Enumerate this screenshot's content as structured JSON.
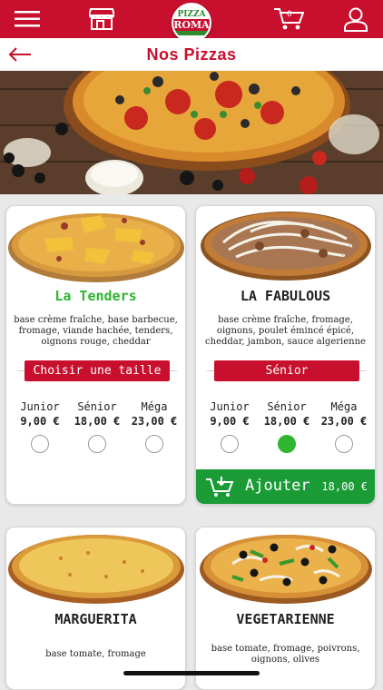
{
  "header": {
    "logo_line1": "PIZZA",
    "logo_line2": "ROMA",
    "cart_count": "0",
    "icons": [
      "menu-icon",
      "store-icon",
      "cart-icon",
      "user-icon"
    ],
    "accent_color": "#c8102e"
  },
  "titlebar": {
    "title": "Nos Pizzas",
    "back_icon": "arrow-left-icon"
  },
  "pizzas": [
    {
      "name": "La Tenders",
      "description": "base crème fraîche, base barbecue, fromage, viande hachée, tenders, oignons rouge, cheddar",
      "select_label": "Choisir une taille",
      "sizes": [
        {
          "label": "Junior",
          "price": "9,00 €",
          "selected": false
        },
        {
          "label": "Sénior",
          "price": "18,00 €",
          "selected": false
        },
        {
          "label": "Méga",
          "price": "23,00 €",
          "selected": false
        }
      ]
    },
    {
      "name": "LA FABULOUS",
      "description": "base crème fraîche, fromage, oignons, poulet émincé épicé, cheddar, jambon, sauce algerienne",
      "select_label": "Sénior",
      "sizes": [
        {
          "label": "Junior",
          "price": "9,00 €",
          "selected": false
        },
        {
          "label": "Sénior",
          "price": "18,00 €",
          "selected": true
        },
        {
          "label": "Méga",
          "price": "23,00 €",
          "selected": false
        }
      ],
      "add_label": "Ajouter",
      "add_price": "18,00 €"
    },
    {
      "name": "MARGUERITA",
      "description": "base tomate, fromage"
    },
    {
      "name": "VEGETARIENNE",
      "description": "base tomate, fromage, poivrons, oignons, olives"
    }
  ]
}
